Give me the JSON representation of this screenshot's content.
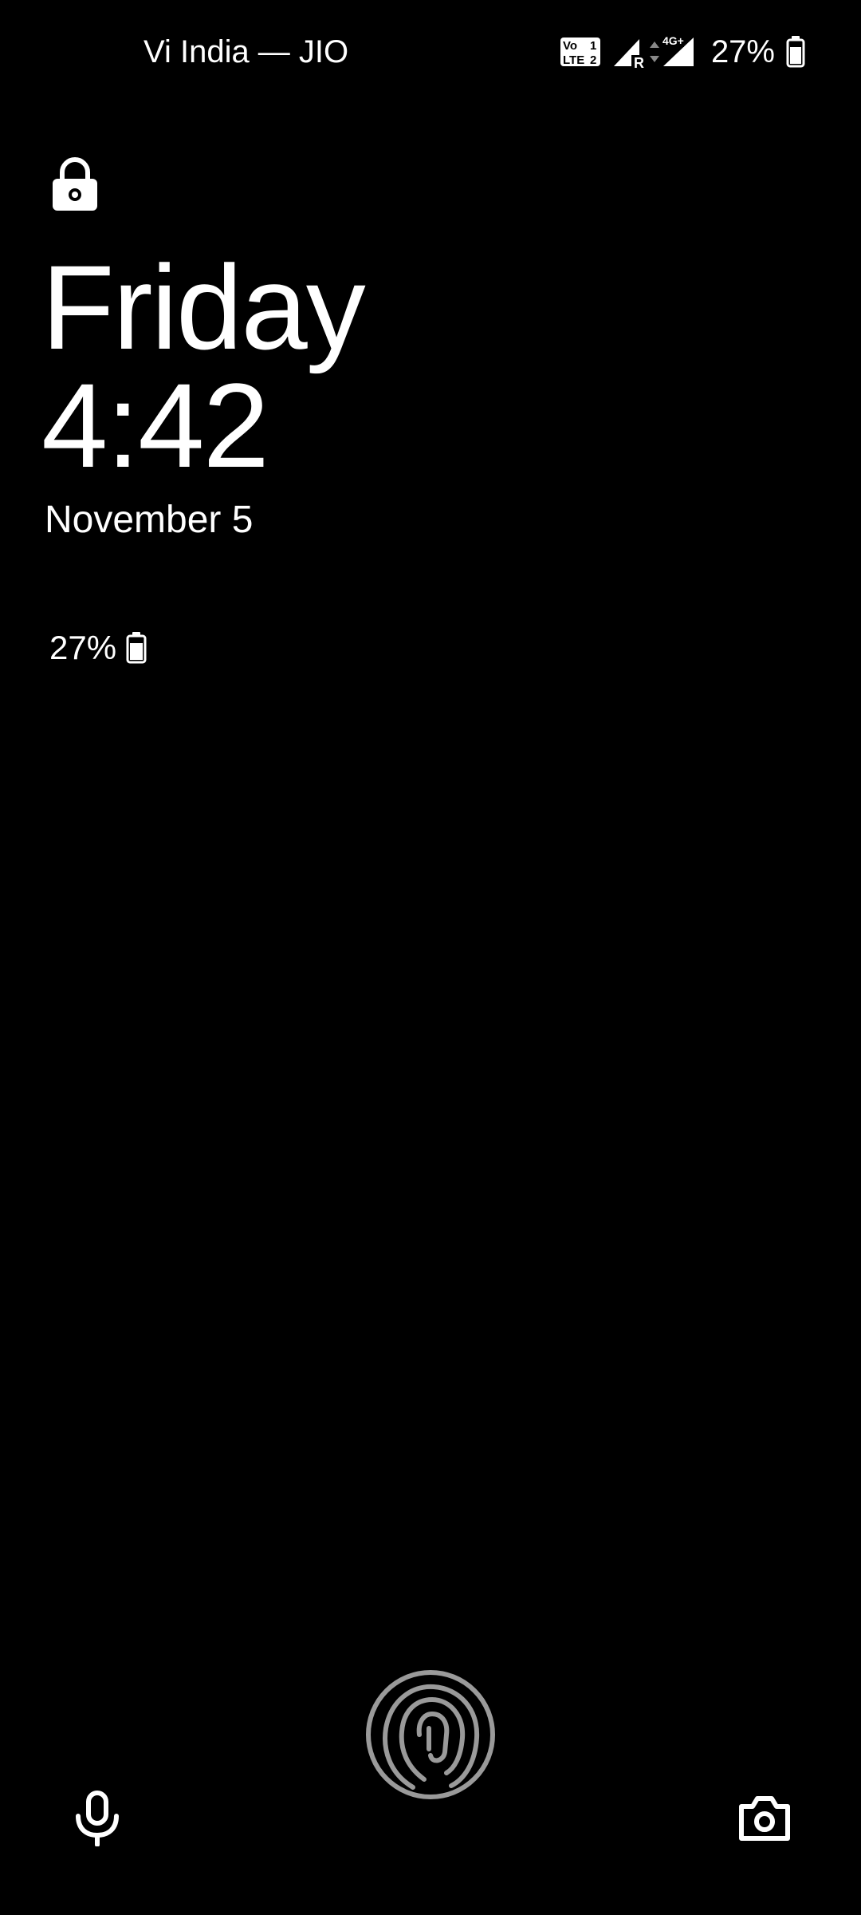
{
  "status_bar": {
    "carrier": "Vi India — JIO",
    "volte_line1": "Vo",
    "volte_line2": "LTE",
    "sim1": "1",
    "sim2": "2",
    "roaming": "R",
    "network_type": "4G+",
    "battery_percent": "27%"
  },
  "lockscreen": {
    "day": "Friday",
    "time": "4:42",
    "date": "November 5",
    "battery_percent": "27%",
    "battery_level": 0.27
  },
  "icons": {
    "lock": "lock-icon",
    "fingerprint": "fingerprint-icon",
    "voice_assistant": "microphone-icon",
    "camera": "camera-icon"
  },
  "colors": {
    "background": "#000000",
    "foreground": "#ffffff",
    "fingerprint": "#9a9a9a"
  }
}
